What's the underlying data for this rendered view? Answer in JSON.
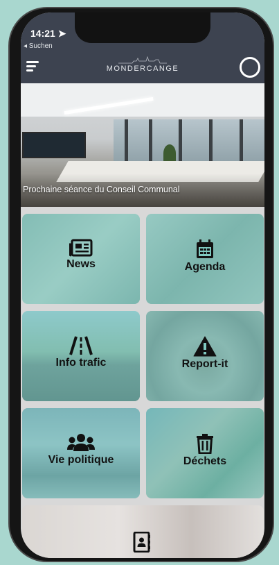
{
  "status_bar": {
    "time": "14:21",
    "back_link": "◂ Suchen"
  },
  "header": {
    "logo_text": "MONDERCANGE"
  },
  "banner": {
    "caption": "Prochaine séance du Conseil Communal"
  },
  "tiles": [
    {
      "label": "News",
      "icon": "newspaper-icon"
    },
    {
      "label": "Agenda",
      "icon": "calendar-icon"
    },
    {
      "label": "Info trafic",
      "icon": "road-icon"
    },
    {
      "label": "Report-it",
      "icon": "warning-icon"
    },
    {
      "label": "Vie politique",
      "icon": "users-icon"
    },
    {
      "label": "Déchets",
      "icon": "trash-icon"
    }
  ],
  "bottom_tile": {
    "icon": "address-book-icon"
  },
  "colors": {
    "header": "#3d4350",
    "tile_overlay": "#6ec4bc",
    "background": "#a9d7cf"
  }
}
